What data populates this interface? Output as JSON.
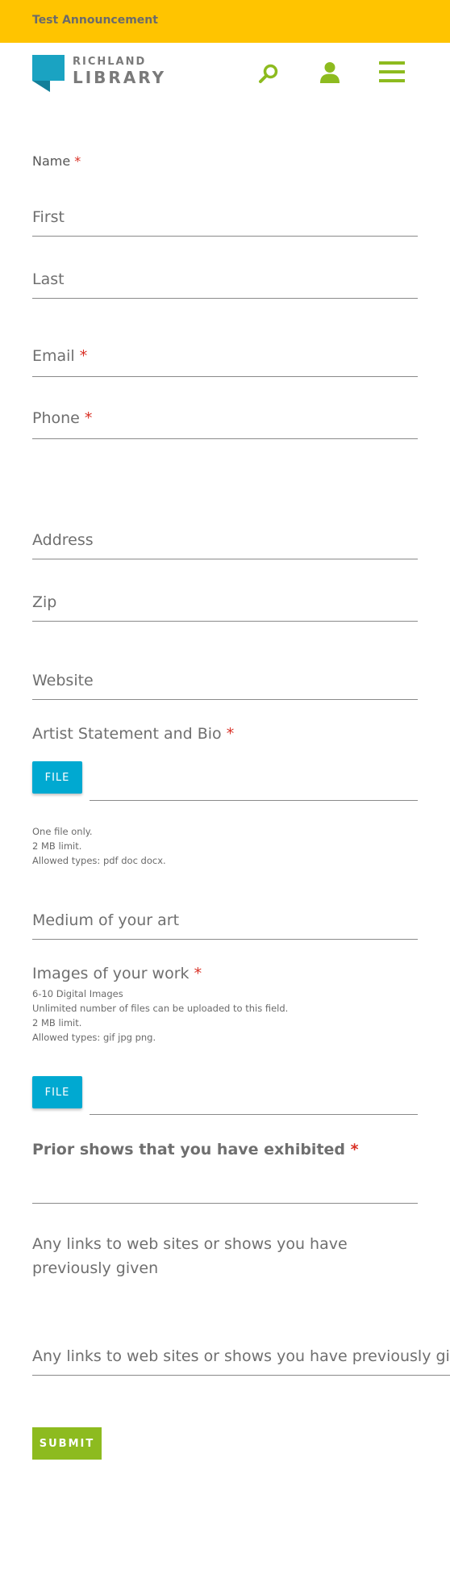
{
  "announcement": {
    "text": "Test Announcement"
  },
  "header": {
    "logo_line1": "RICHLAND",
    "logo_line2": "LIBRARY",
    "logo_mark": "®",
    "icons": [
      "search-icon",
      "user-icon",
      "menu-icon"
    ]
  },
  "colors": {
    "announcement_bg": "#ffc400",
    "accent_green": "#8dbb1f",
    "file_button": "#00a9d1",
    "required": "#d93025",
    "logo_teal": "#1aa3c2"
  },
  "form": {
    "name_label": "Name",
    "required_mark": "*",
    "first_placeholder": "First",
    "last_placeholder": "Last",
    "email_label": "Email",
    "phone_label": "Phone",
    "address_placeholder": "Address",
    "zip_placeholder": "Zip",
    "website_placeholder": "Website",
    "artist_statement_label": "Artist Statement and Bio",
    "file_button_label": "FILE",
    "artist_desc": [
      "One file only.",
      "2 MB limit.",
      "Allowed types: pdf doc docx."
    ],
    "medium_placeholder": "Medium of your art",
    "images_label": "Images of your work",
    "images_desc": [
      "6-10 Digital Images",
      "Unlimited number of files can be uploaded to this field.",
      "2 MB limit.",
      "Allowed types: gif jpg png."
    ],
    "prior_shows_label": "Prior shows that you have exhibited",
    "links_label": "Any links to web sites or shows you have previously given",
    "links_placeholder": "Any links to web sites or shows you have previously given",
    "submit_label": "SUBMIT"
  }
}
